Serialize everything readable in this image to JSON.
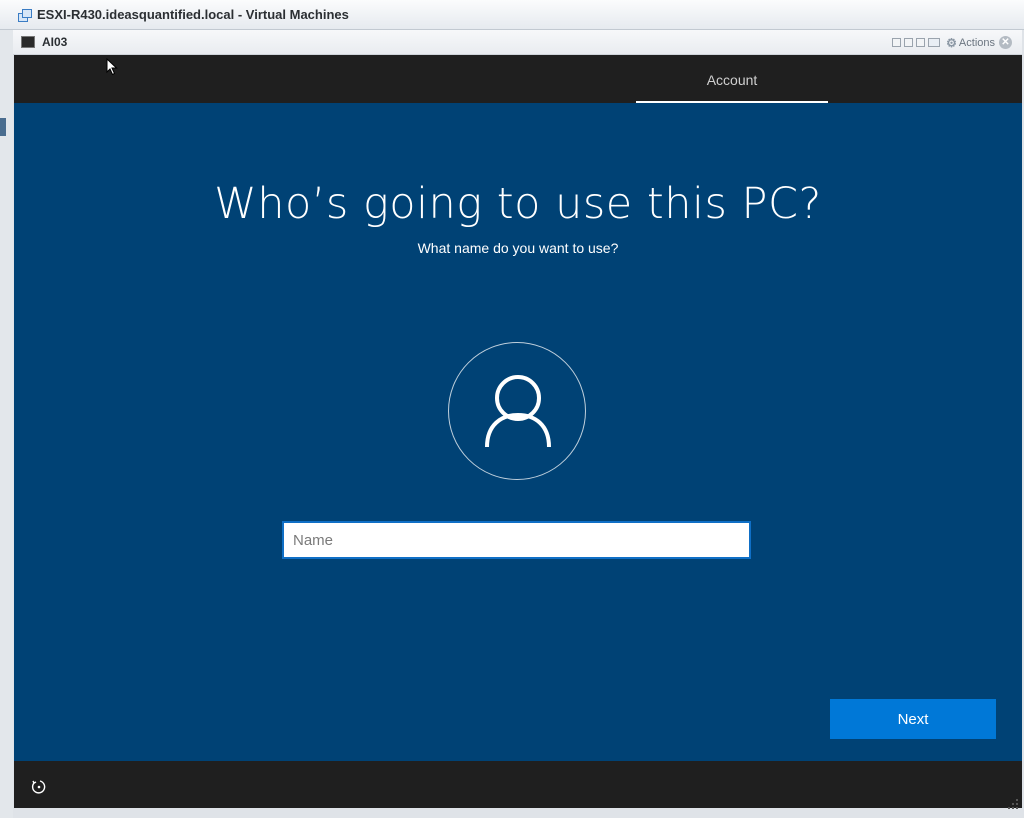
{
  "window": {
    "title": "ESXI-R430.ideasquantified.local - Virtual Machines"
  },
  "console_bar": {
    "vm_name": "AI03",
    "actions_label": "Actions"
  },
  "oobe": {
    "tab_label": "Account",
    "heading": "Who’s going to use this PC?",
    "subheading": "What name do you want to use?",
    "name_input": {
      "value": "",
      "placeholder": "Name"
    },
    "next_label": "Next"
  },
  "colors": {
    "background": "#004275",
    "bars": "#1f1f1f",
    "accent": "#0078d7"
  }
}
